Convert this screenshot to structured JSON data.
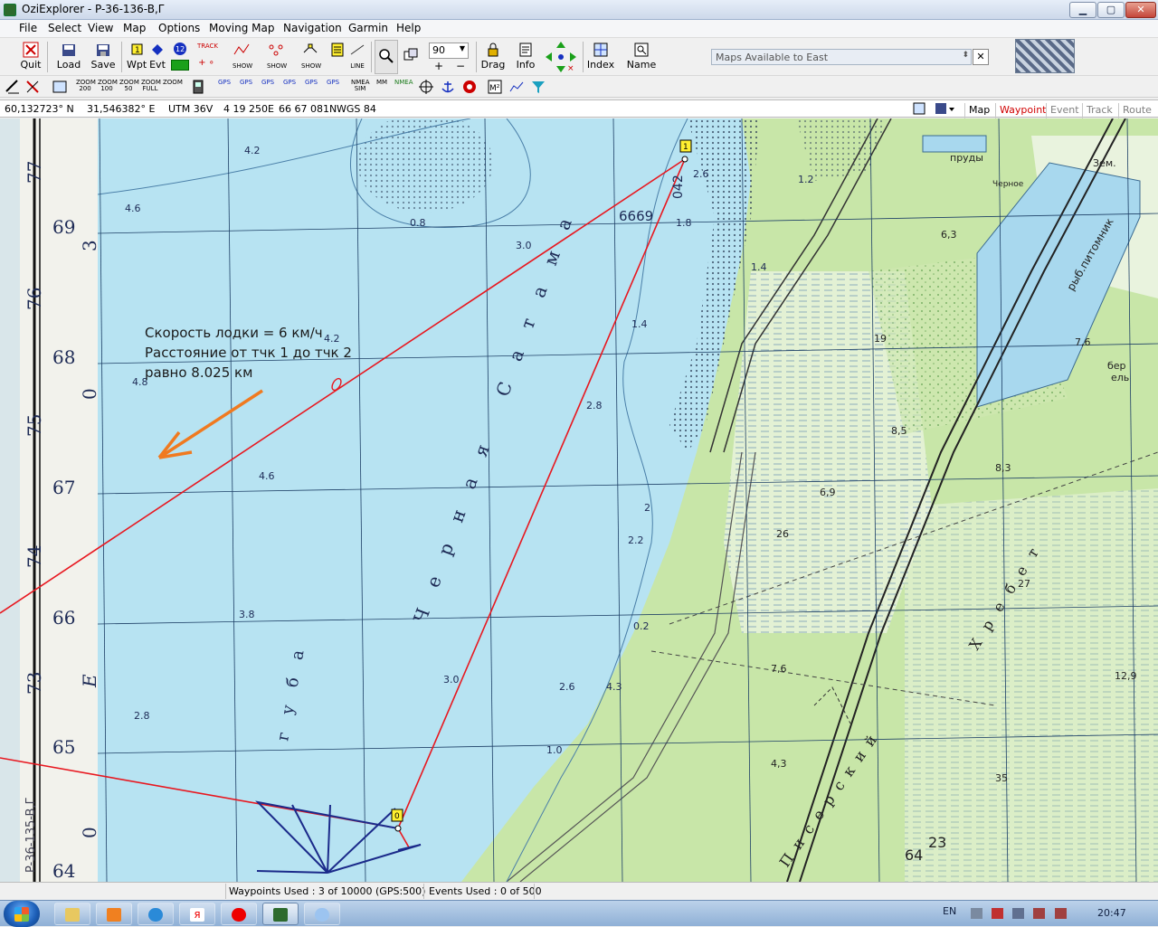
{
  "window": {
    "title": "OziExplorer - P-36-136-B,Γ"
  },
  "menu": [
    "File",
    "Select",
    "View",
    "Map",
    "Options",
    "Moving Map",
    "Navigation",
    "Garmin",
    "Help"
  ],
  "toolbar1": {
    "quit": "Quit",
    "load": "Load",
    "save": "Save",
    "wpt": "Wpt",
    "evt": "Evt",
    "track": "TRACK",
    "show1": "SHOW",
    "show2": "SHOW",
    "show3": "SHOW",
    "line": "LINE",
    "zoom_value": "90",
    "drag": "Drag",
    "info": "Info",
    "index": "Index",
    "name": "Name",
    "maps_east": "Maps Available to East"
  },
  "toolbar2": {
    "zoom200": "ZOOM 200",
    "zoom100": "ZOOM 100",
    "zoom50": "ZOOM 50",
    "zoomfull": "ZOOM FULL",
    "zoom_label": "ZOOM",
    "gps": "GPS",
    "nmea_sim": "NMEA SIM",
    "mm": "MM",
    "nmea": "NMEA"
  },
  "coords": {
    "lat": "60,132723° N",
    "lon": "31,546382° E",
    "utm": "UTM  36V",
    "easting": "4 19 250E",
    "northing": "66 67 081N",
    "datum": "WGS 84"
  },
  "modes": {
    "map": "Map",
    "waypoint": "Waypoint",
    "event": "Event",
    "track": "Track",
    "route": "Route"
  },
  "map": {
    "annotation": "Скорость лодки = 6 км/ч\nРасстояние от тчк 1 до тчк 2\nравно 8.025 км",
    "wp1": "1",
    "wp0": "0",
    "grid_left_labels": [
      "77",
      "3",
      "69",
      "76",
      "68",
      "0",
      "75",
      "67",
      "74",
      "66",
      "73",
      "E",
      "65",
      "0",
      "64"
    ],
    "depths": [
      "4.2",
      "4.6",
      "0.8",
      "3.0",
      "2.6",
      "1.8",
      "1.2",
      "1.4",
      "1.4",
      "4.8",
      "2.8",
      "4.6",
      "2.2",
      "3.8",
      "0.2",
      "3.0",
      "2.6",
      "4.3",
      "2.8",
      "1.0",
      "2"
    ],
    "water_lettering": [
      "Черная Сатама",
      "губа"
    ],
    "land_labels": [
      "пруды",
      "Черное",
      "Зем.",
      "6,3",
      "рыб.питомник",
      "7,6",
      "бер",
      "ель",
      "8,5",
      "8,3",
      "19",
      "6,9",
      "26",
      "27",
      "7,6",
      "12,9",
      "4,3",
      "35",
      "64",
      "23",
      "Писерский",
      "Хребет"
    ],
    "sheet_label": "P-36-135-B,Г",
    "height_6669": "6669",
    "depth_2": "042"
  },
  "status": {
    "waypoints": "Waypoints Used : 3 of 10000  (GPS:500)",
    "events": "Events Used : 0 of 500"
  },
  "taskbar": {
    "lang": "EN",
    "clock": "20:47"
  },
  "colors": {
    "water": "#b7e3f2",
    "land": "#c8e6a8",
    "route": "#e8171f",
    "arrow": "#f07a20",
    "fan": "#1b2a8a",
    "waypoint_active": "#d00000"
  }
}
